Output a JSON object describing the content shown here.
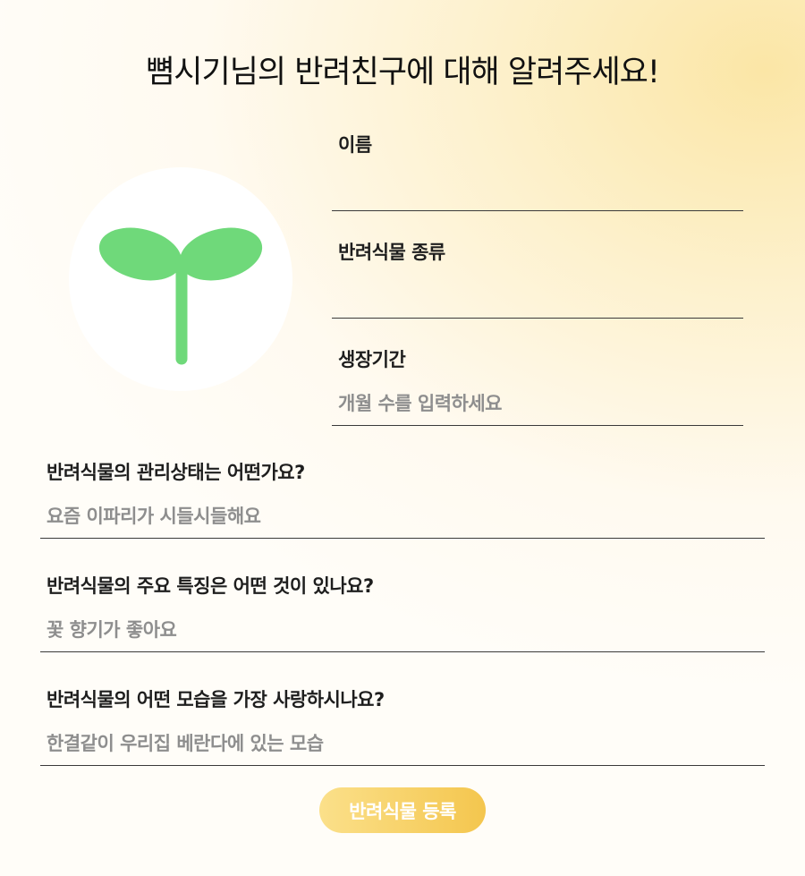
{
  "page": {
    "title": "뼘시기님의 반려친구에 대해 알려주세요!"
  },
  "avatar": {
    "icon": "sprout-icon",
    "color": "#6fd97a"
  },
  "form": {
    "name": {
      "label": "이름",
      "value": "",
      "placeholder": ""
    },
    "kind": {
      "label": "반려식물 종류",
      "value": "",
      "placeholder": ""
    },
    "period": {
      "label": "생장기간",
      "placeholder": "개월 수를 입력하세요"
    },
    "care": {
      "label": "반려식물의 관리상태는 어떤가요?",
      "placeholder": "요즘 이파리가 시들시들해요"
    },
    "feature": {
      "label": "반려식물의 주요 특징은 어떤 것이 있나요?",
      "placeholder": "꽃 향기가 좋아요"
    },
    "love": {
      "label": "반려식물의 어떤 모습을 가장 사랑하시나요?",
      "placeholder": "한결같이 우리집 베란다에 있는 모습"
    }
  },
  "submit": {
    "label": "반려식물 등록",
    "gradient_start": "#fbe08a",
    "gradient_end": "#f4c64e"
  }
}
